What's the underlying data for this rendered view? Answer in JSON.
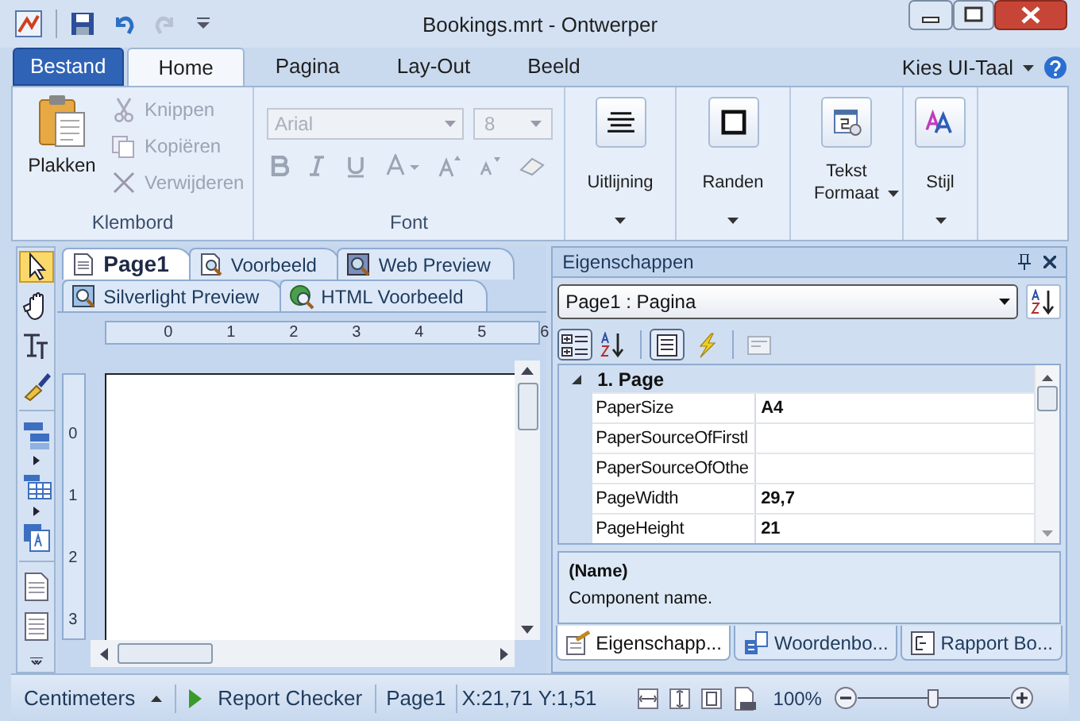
{
  "window": {
    "title": "Bookings.mrt - Ontwerper"
  },
  "ribbon_tabs": [
    {
      "label": "Bestand",
      "kind": "file",
      "selected": false
    },
    {
      "label": "Home",
      "kind": "tab",
      "selected": true
    },
    {
      "label": "Pagina",
      "kind": "tab",
      "selected": false
    },
    {
      "label": "Lay-Out",
      "kind": "tab",
      "selected": false
    },
    {
      "label": "Beeld",
      "kind": "tab",
      "selected": false
    }
  ],
  "language_menu": "Kies UI-Taal",
  "clipboard": {
    "label": "Klembord",
    "paste": "Plakken",
    "items": [
      {
        "label": "Knippen",
        "kind": "cut",
        "disabled": true
      },
      {
        "label": "Kopiëren",
        "kind": "copy",
        "disabled": true
      },
      {
        "label": "Verwijderen",
        "kind": "delete",
        "disabled": true
      }
    ]
  },
  "font": {
    "label": "Font",
    "font_name": "Arial",
    "font_size": "8",
    "disabled": true
  },
  "ribbon_buttons": [
    {
      "label": "Uitlijning",
      "kind": "align"
    },
    {
      "label": "Randen",
      "kind": "borders"
    },
    {
      "label": "Tekst Formaat",
      "kind": "format"
    },
    {
      "label": "Stijl",
      "kind": "style"
    }
  ],
  "toolbox": [
    {
      "kind": "pointer",
      "selected": true
    },
    {
      "kind": "hand",
      "selected": false
    },
    {
      "kind": "text",
      "selected": false
    },
    {
      "kind": "brush",
      "selected": false
    },
    {
      "kind": "bands",
      "selected": false
    },
    {
      "kind": "table",
      "selected": false
    },
    {
      "kind": "component",
      "selected": false
    },
    {
      "kind": "page",
      "selected": false
    },
    {
      "kind": "sheet",
      "selected": false
    }
  ],
  "doc_tabs": [
    [
      {
        "label": "Page1",
        "kind": "page",
        "selected": true
      },
      {
        "label": "Voorbeeld",
        "kind": "preview",
        "selected": false
      },
      {
        "label": "Web Preview",
        "kind": "web",
        "selected": false
      }
    ],
    [
      {
        "label": "Silverlight Preview",
        "kind": "silverlight",
        "selected": false
      },
      {
        "label": "HTML Voorbeeld",
        "kind": "html",
        "selected": false
      }
    ]
  ],
  "ruler": {
    "horizontal": [
      "0",
      "1",
      "2",
      "3",
      "4",
      "5",
      "6"
    ],
    "vertical": [
      "0",
      "1",
      "2",
      "3"
    ]
  },
  "properties": {
    "title": "Eigenschappen",
    "object": "Page1 : Pagina",
    "toolbar": [
      {
        "kind": "categorized",
        "selected": true
      },
      {
        "kind": "alphabetical",
        "selected": false
      },
      {
        "kind": "properties",
        "selected": true
      },
      {
        "kind": "events",
        "selected": false
      },
      {
        "kind": "pages",
        "selected": false
      }
    ],
    "category": {
      "label": "1. Page",
      "expanded": true
    },
    "rows": [
      {
        "name": "PaperSize",
        "value": "A4"
      },
      {
        "name": "PaperSourceOfFirstl"
      },
      {
        "name": "PaperSourceOfOthe"
      },
      {
        "name": "PageWidth",
        "value": "29,7"
      },
      {
        "name": "PageHeight",
        "value": "21"
      }
    ],
    "description": {
      "title": "(Name)",
      "text": "Component name."
    },
    "tabs": [
      {
        "label": "Eigenschapp...",
        "kind": "properties",
        "selected": true
      },
      {
        "label": "Woordenbo...",
        "kind": "dictionary",
        "selected": false
      },
      {
        "label": "Rapport Bo...",
        "kind": "tree",
        "selected": false
      }
    ]
  },
  "status_bar": {
    "units": "Centimeters",
    "checker": "Report Checker",
    "page": "Page1",
    "coords": "X:21,71 Y:1,51",
    "zoom": "100%",
    "zoom_level": {
      "level": 0.5
    }
  }
}
